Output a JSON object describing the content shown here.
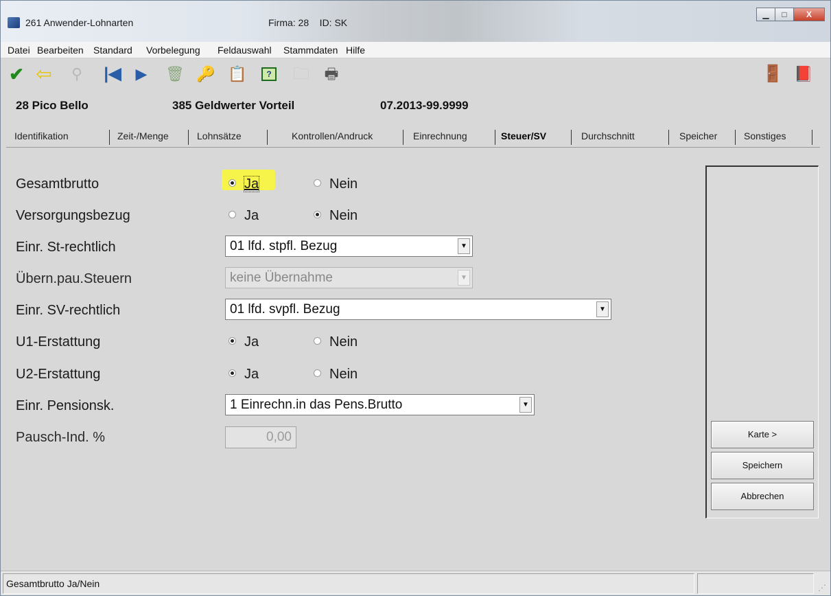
{
  "window": {
    "title": "261 Anwender-Lohnarten",
    "firma_label": "Firma: 28    ID: SK",
    "buttons": {
      "minimize": "▁",
      "maximize": "□",
      "close": "X"
    }
  },
  "menu": [
    "Datei",
    "Bearbeiten",
    "Standard",
    "Vorbelegung",
    "Feldauswahl",
    "Stammdaten",
    "Hilfe"
  ],
  "toolbar": {
    "icons": [
      "checkmark-icon",
      "back-arrow-icon",
      "binoculars-icon",
      "first-record-icon",
      "next-record-icon",
      "recycle-bin-icon",
      "key-icon",
      "export-icon",
      "help-icon",
      "folder-icon",
      "print-icon",
      "exit-door-icon",
      "book-icon"
    ]
  },
  "header": {
    "company": "28 Pico Bello",
    "lohnart": "385 Geldwerter Vorteil",
    "period": "07.2013-99.9999"
  },
  "tabs": [
    "Identifikation",
    "Zeit-/Menge",
    "Lohnsätze",
    "Kontrollen/Andruck",
    "Einrechnung",
    "Steuer/SV",
    "Durchschnitt",
    "Speicher",
    "Sonstiges"
  ],
  "active_tab": "Steuer/SV",
  "form": {
    "gesamtbrutto": {
      "label": "Gesamtbrutto",
      "ja": "Ja",
      "nein": "Nein",
      "value": "Ja"
    },
    "versorgungsbezug": {
      "label": "Versorgungsbezug",
      "ja": "Ja",
      "nein": "Nein",
      "value": "Nein"
    },
    "einr_st": {
      "label": "Einr. St-rechtlich",
      "value": "01 lfd. stpfl. Bezug"
    },
    "uebern": {
      "label": "Übern.pau.Steuern",
      "value": "keine Übernahme"
    },
    "einr_sv": {
      "label": "Einr. SV-rechtlich",
      "value": "01 lfd. svpfl. Bezug"
    },
    "u1": {
      "label": "U1-Erstattung",
      "ja": "Ja",
      "nein": "Nein",
      "value": "Ja"
    },
    "u2": {
      "label": "U2-Erstattung",
      "ja": "Ja",
      "nein": "Nein",
      "value": "Ja"
    },
    "pension": {
      "label": "Einr. Pensionsk.",
      "value": "1 Einrechn.in das Pens.Brutto"
    },
    "pausch": {
      "label": "Pausch-Ind. %",
      "value": "0,00"
    }
  },
  "side_buttons": {
    "karte": "Karte >",
    "speichern": "Speichern",
    "abbrechen": "Abbrechen"
  },
  "status": {
    "text": "Gesamtbrutto Ja/Nein"
  },
  "colors": {
    "highlight": "#f6f34a",
    "window_bg": "#d8d8d8"
  }
}
